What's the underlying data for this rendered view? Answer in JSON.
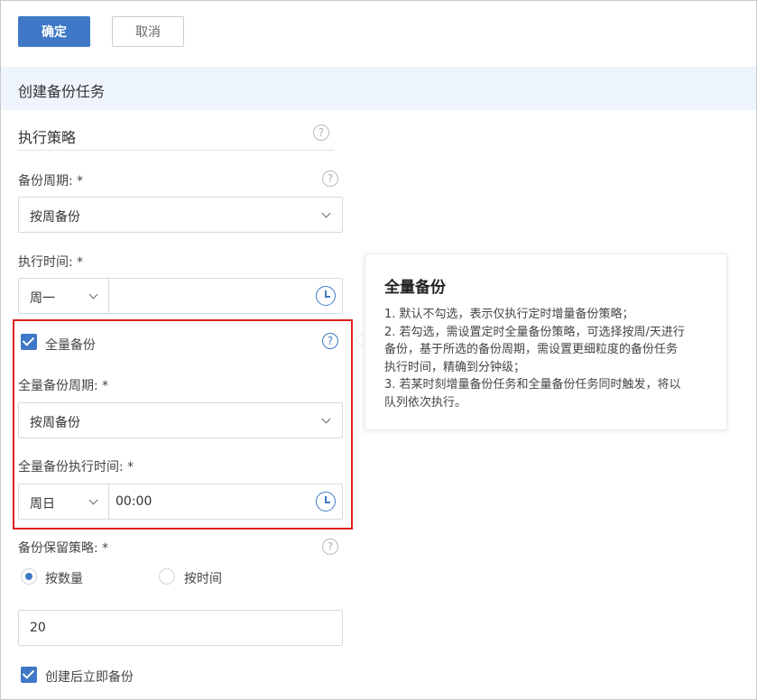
{
  "toolbar": {
    "confirm_label": "确定",
    "cancel_label": "取消"
  },
  "section": {
    "title": "创建备份任务"
  },
  "strategy": {
    "title": "执行策略",
    "help": "?"
  },
  "backup_cycle": {
    "label": "备份周期: *",
    "value": "按周备份",
    "help": "?"
  },
  "exec_time": {
    "label": "执行时间: *",
    "day": "周一",
    "time": ""
  },
  "full_backup": {
    "checkbox_label": "全量备份",
    "help": "?",
    "cycle_label": "全量备份周期: *",
    "cycle_value": "按周备份",
    "time_label": "全量备份执行时间: *",
    "day": "周日",
    "time": "00:00"
  },
  "retention": {
    "label": "备份保留策略: *",
    "help": "?",
    "option_count": "按数量",
    "option_time": "按时间",
    "selected": "按数量",
    "value": "20"
  },
  "immediate": {
    "label": "创建后立即备份"
  },
  "tooltip": {
    "title": "全量备份",
    "lines": [
      "1. 默认不勾选，表示仅执行定时增量备份策略；",
      "2. 若勾选，需设置定时全量备份策略，可选择按周/天进行",
      "备份，基于所选的备份周期，需设置更细粒度的备份任务",
      "执行时间，精确到分钟级；",
      "3. 若某时刻增量备份任务和全量备份任务同时触发，将以",
      "队列依次执行。"
    ]
  },
  "colors": {
    "primary": "#3f78c6",
    "highlight_border": "#e01e1e",
    "section_bg": "#eef4fb"
  }
}
